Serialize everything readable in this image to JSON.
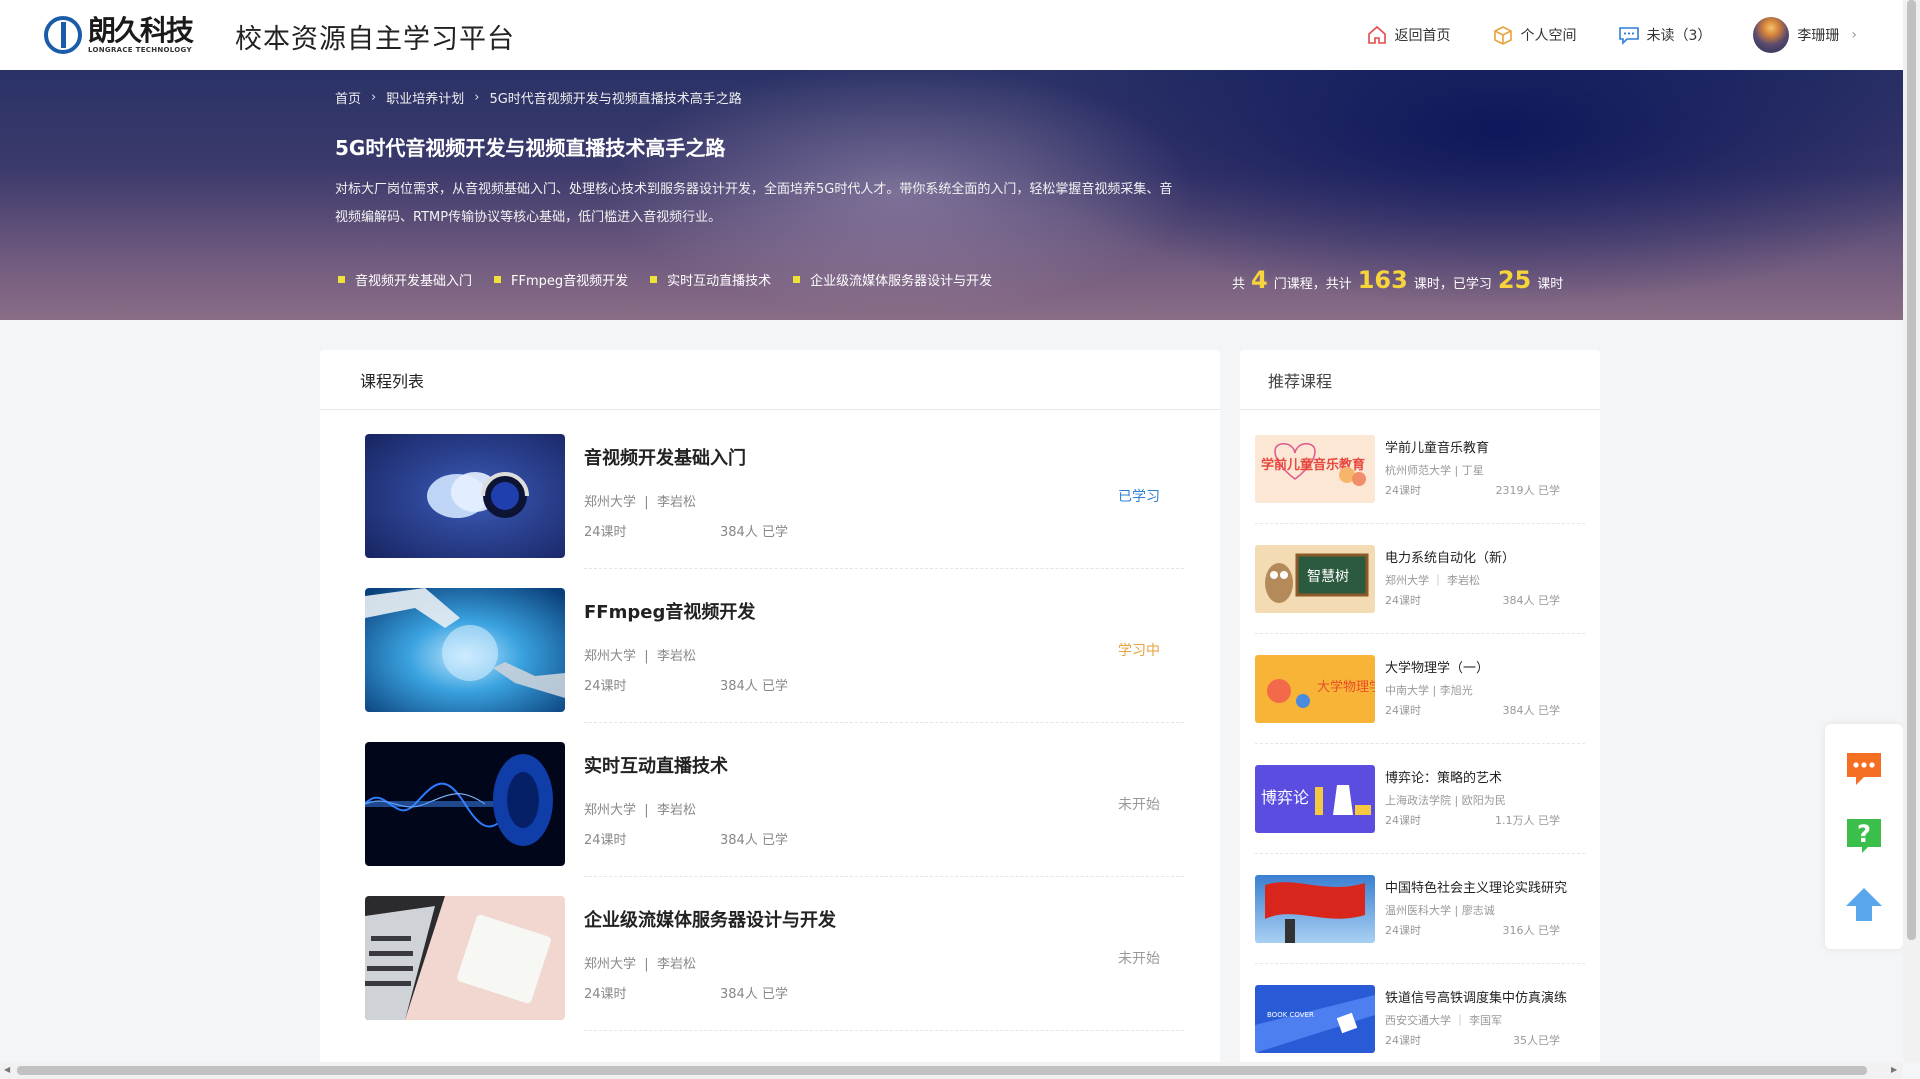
{
  "header": {
    "logo_cn": "朗久科技",
    "logo_en": "LONGRACE TECHNOLOGY",
    "site_title": "校本资源自主学习平台",
    "nav": {
      "home": "返回首页",
      "space": "个人空间",
      "unread": "未读（3）",
      "user": "李珊珊"
    }
  },
  "banner": {
    "breadcrumb": [
      "首页",
      "职业培养计划",
      "5G时代音视频开发与视频直播技术高手之路"
    ],
    "title": "5G时代音视频开发与视频直播技术高手之路",
    "description": "对标大厂岗位需求，从音视频基础入门、处理核心技术到服务器设计开发，全面培养5G时代人才。带你系统全面的入门，轻松掌握音视频采集、音视频编解码、RTMP传输协议等核心基础，低门槛进入音视频行业。",
    "tags": [
      "音视频开发基础入门",
      "FFmpeg音视频开发",
      "实时互动直播技术",
      "企业级流媒体服务器设计与开发"
    ],
    "stats": {
      "prefix": "共",
      "courses": "4",
      "courses_unit": "门课程，共计",
      "hours": "163",
      "hours_unit": "课时，已学习",
      "learned": "25",
      "learned_unit": "课时"
    }
  },
  "course_list": {
    "heading": "课程列表",
    "items": [
      {
        "title": "音视频开发基础入门",
        "school": "郑州大学",
        "teacher": "李岩松",
        "hours": "24课时",
        "learners": "384人 已学",
        "status": "已学习",
        "status_color": "#2f7fd6"
      },
      {
        "title": "FFmpeg音视频开发",
        "school": "郑州大学",
        "teacher": "李岩松",
        "hours": "24课时",
        "learners": "384人 已学",
        "status": "学习中",
        "status_color": "#e6a23c"
      },
      {
        "title": "实时互动直播技术",
        "school": "郑州大学",
        "teacher": "李岩松",
        "hours": "24课时",
        "learners": "384人 已学",
        "status": "未开始",
        "status_color": "#999999"
      },
      {
        "title": "企业级流媒体服务器设计与开发",
        "school": "郑州大学",
        "teacher": "李岩松",
        "hours": "24课时",
        "learners": "384人 已学",
        "status": "未开始",
        "status_color": "#999999"
      }
    ]
  },
  "recommend": {
    "heading": "推荐课程",
    "items": [
      {
        "title": "学前儿童音乐教育",
        "meta": "杭州师范大学 | 丁星",
        "hours": "24课时",
        "learners": "2319人 已学"
      },
      {
        "title": "电力系统自动化（新）",
        "meta": "郑州大学 ｜ 李岩松",
        "hours": "24课时",
        "learners": "384人 已学"
      },
      {
        "title": "大学物理学（一）",
        "meta": "中南大学 | 李旭光",
        "hours": "24课时",
        "learners": "384人 已学"
      },
      {
        "title": "博弈论：策略的艺术",
        "meta": "上海政法学院 | 欧阳为民",
        "hours": "24课时",
        "learners": "1.1万人 已学"
      },
      {
        "title": "中国特色社会主义理论实践研究",
        "meta": "温州医科大学 | 廖志诚",
        "hours": "24课时",
        "learners": "316人 已学"
      },
      {
        "title": "铁道信号高铁调度集中仿真演练",
        "meta": "西安交通大学 ｜ 李国军",
        "hours": "24课时",
        "learners": "35人已学"
      }
    ],
    "thumb_text": [
      "学前儿童音乐教育",
      "智慧树",
      "大学物理学",
      "博弈论",
      "",
      "BOOK COVER"
    ]
  },
  "float_toolbar": {
    "icons": [
      "chat-icon",
      "help-icon",
      "back-to-top-icon"
    ],
    "colors": {
      "chat": "#f56f23",
      "help": "#3cbe4a",
      "top": "#5aa7ee"
    }
  },
  "colors": {
    "accent": "#f7d33c",
    "tag_dot": "#f0e03a"
  }
}
